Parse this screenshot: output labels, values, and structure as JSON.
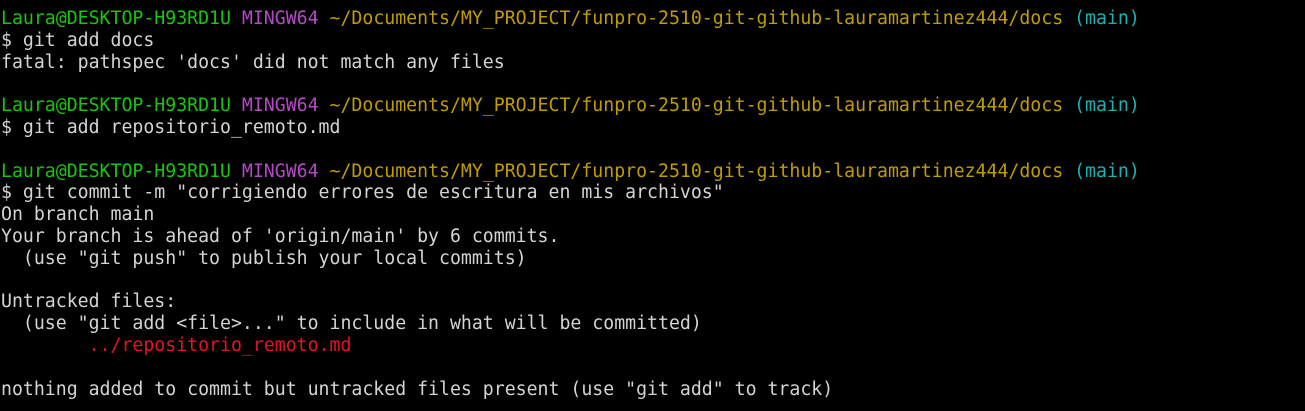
{
  "prompt": {
    "user_host": "Laura@DESKTOP-H93RD1U",
    "env": "MINGW64",
    "path": "~/Documents/MY_PROJECT/funpro-2510-git-github-lauramartinez444/docs",
    "branch": "(main)",
    "symbol": "$"
  },
  "blocks": [
    {
      "command": "git add docs",
      "output": [
        "fatal: pathspec 'docs' did not match any files"
      ]
    },
    {
      "command": "git add repositorio_remoto.md",
      "output": []
    },
    {
      "command": "git commit -m \"corrigiendo errores de escritura en mis archivos\"",
      "output": [
        "On branch main",
        "Your branch is ahead of 'origin/main' by 6 commits.",
        "  (use \"git push\" to publish your local commits)",
        "",
        "Untracked files:",
        "  (use \"git add <file>...\" to include in what will be committed)"
      ],
      "untracked_file_indent": "        ",
      "untracked_file": "../repositorio_remoto.md",
      "final_line": "nothing added to commit but untracked files present (use \"git add\" to track)"
    }
  ],
  "colors": {
    "user_host": "#16c60c",
    "env": "#b548c6",
    "path": "#c19c00",
    "branch": "#18b2b2",
    "untracked": "#e81123",
    "text": "#d4d4d4",
    "background": "#000000"
  }
}
